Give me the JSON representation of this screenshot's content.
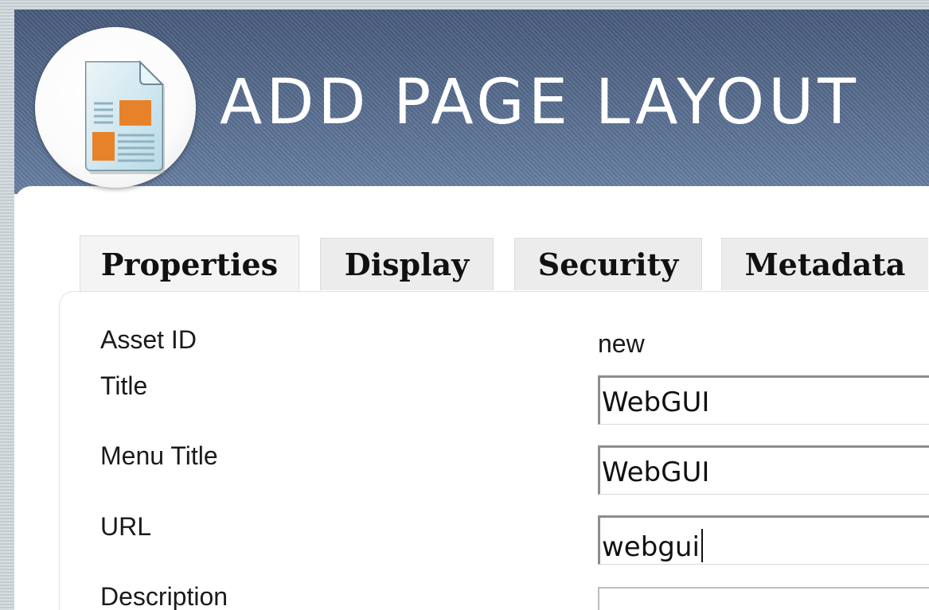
{
  "header": {
    "title": "ADD PAGE LAYOUT",
    "icon": "page-layout-icon",
    "colors": {
      "header_top": "#46597a",
      "header_bottom": "#667ea2",
      "icon_accent": "#e8822a"
    }
  },
  "tabs": [
    {
      "label": "Properties",
      "active": true
    },
    {
      "label": "Display",
      "active": false
    },
    {
      "label": "Security",
      "active": false
    },
    {
      "label": "Metadata",
      "active": false
    }
  ],
  "form": {
    "asset_id": {
      "label": "Asset ID",
      "value": "new"
    },
    "title": {
      "label": "Title",
      "value": "WebGUI"
    },
    "menu_title": {
      "label": "Menu Title",
      "value": "WebGUI"
    },
    "url": {
      "label": "URL",
      "value": "webgui"
    },
    "description": {
      "label": "Description",
      "value": ""
    }
  }
}
